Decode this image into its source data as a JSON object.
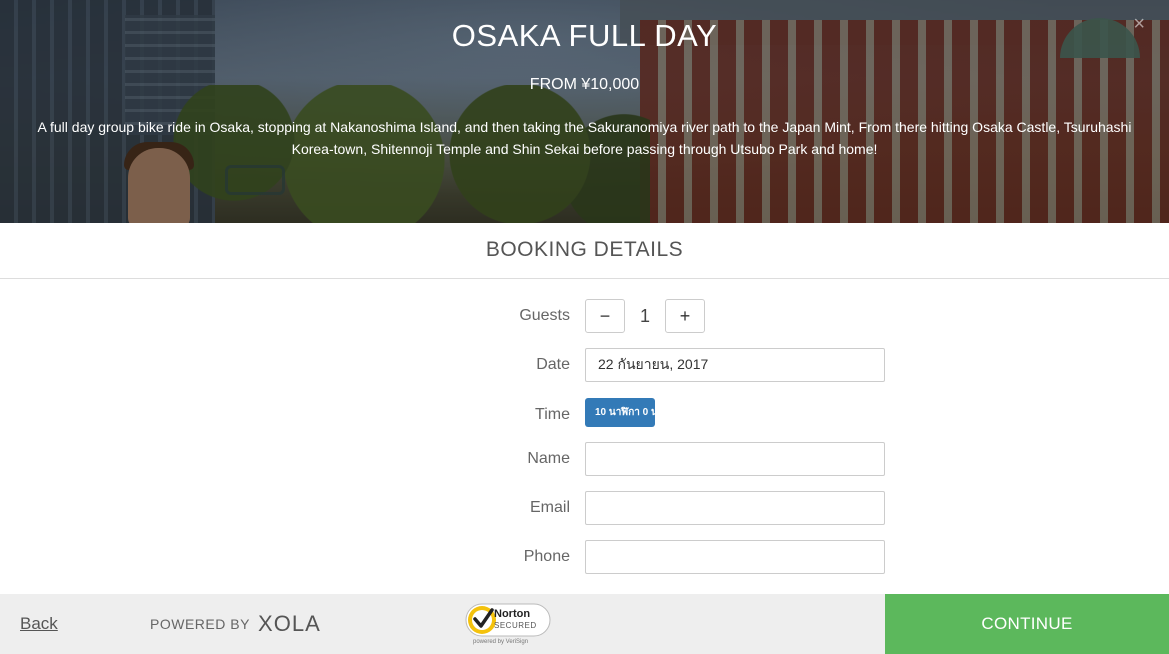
{
  "hero": {
    "title": "OSAKA FULL DAY",
    "price": "FROM ¥10,000",
    "description": "A full day group bike ride in Osaka, stopping at Nakanoshima Island, and then taking the Sakuranomiya river path to the Japan Mint, From there hitting Osaka Castle, Tsuruhashi Korea-town, Shitennoji Temple and Shin Sekai before passing through Utsubo Park and home!",
    "close_glyph": "×"
  },
  "booking": {
    "title": "BOOKING DETAILS",
    "guests": {
      "label": "Guests",
      "minus": "−",
      "value": "1",
      "plus": "+"
    },
    "date": {
      "label": "Date",
      "value": "22 กันยายน, 2017"
    },
    "time": {
      "label": "Time",
      "option": "10 นาฬิกา 0 น"
    },
    "name": {
      "label": "Name",
      "value": ""
    },
    "email": {
      "label": "Email",
      "value": ""
    },
    "phone": {
      "label": "Phone",
      "value": ""
    }
  },
  "footer": {
    "back": "Back",
    "powered_by": "POWERED BY",
    "brand": "XOLA",
    "norton_title": "Norton",
    "norton_sub": "SECURED",
    "norton_powered": "powered by VeriSign",
    "continue": "CONTINUE"
  },
  "colors": {
    "continue_bg": "#5cb85c",
    "time_button_bg": "#337ab7",
    "footer_bg": "#eeeeee"
  }
}
